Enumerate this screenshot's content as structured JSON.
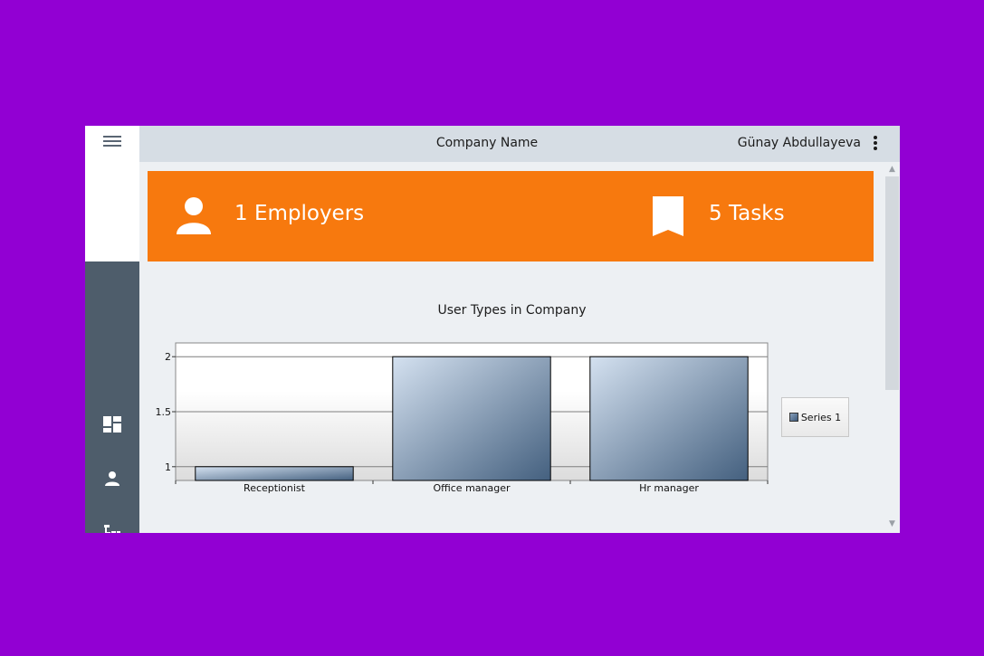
{
  "header": {
    "company_name": "Company Name",
    "user_name": "Günay Abdullayeva"
  },
  "sidebar": {
    "items": [
      {
        "icon": "dashboard-icon"
      },
      {
        "icon": "person-icon"
      },
      {
        "icon": "hierarchy-icon"
      },
      {
        "icon": "airplane-icon"
      },
      {
        "icon": "pie-icon"
      }
    ]
  },
  "banner": {
    "background": "#f7790e",
    "employers_label": "1 Employers",
    "tasks_label": "5 Tasks"
  },
  "chart_data": {
    "type": "bar",
    "title": "User Types in Company",
    "categories": [
      "Receptionist",
      "Office manager",
      "Hr manager"
    ],
    "series": [
      {
        "name": "Series 1",
        "values": [
          1,
          2,
          2
        ]
      }
    ],
    "ylim": [
      0.875,
      2.125
    ],
    "yticks": [
      "1",
      "1.5",
      "2"
    ],
    "ytick_values": [
      1,
      1.5,
      2
    ],
    "grid": true,
    "legend": "right"
  }
}
